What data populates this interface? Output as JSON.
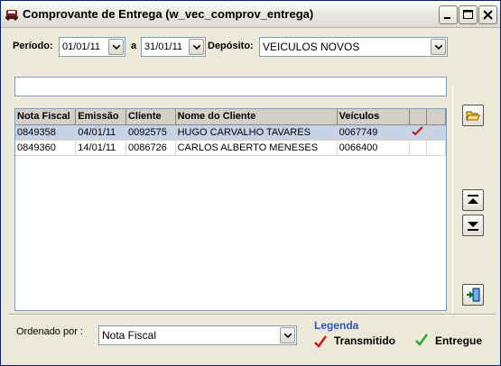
{
  "window": {
    "title": "Comprovante de Entrega (w_vec_comprov_entrega)"
  },
  "filters": {
    "periodo_label": "Período:",
    "date_from": "01/01/11",
    "a_label": "a",
    "date_to": "31/01/11",
    "deposito_label": "Depósito:",
    "deposito_value": "VEICULOS NOVOS"
  },
  "search": {
    "value": ""
  },
  "grid": {
    "columns": [
      "Nota Fiscal",
      "Emissão",
      "Cliente",
      "Nome do Cliente",
      "Veículos",
      "",
      ""
    ],
    "rows": [
      {
        "nota_fiscal": "0849358",
        "emissao": "04/01/11",
        "cliente": "0092575",
        "nome": "HUGO CARVALHO TAVARES",
        "veiculos": "0067749",
        "status": "transmitido"
      },
      {
        "nota_fiscal": "0849360",
        "emissao": "14/01/11",
        "cliente": "0086726",
        "nome": "CARLOS ALBERTO MENESES",
        "veiculos": "0066400",
        "status": ""
      }
    ]
  },
  "sort": {
    "label": "Ordenado por :",
    "value": "Nota Fiscal"
  },
  "legend": {
    "title": "Legenda",
    "transmitido": "Transmitido",
    "entregue": "Entregue",
    "transmitido_color": "#d01010",
    "entregue_color": "#22aa22"
  },
  "icons": {
    "title": "car-icon",
    "open": "folder-open-icon",
    "up": "move-up-icon",
    "down": "move-down-icon",
    "exit": "exit-door-icon"
  }
}
